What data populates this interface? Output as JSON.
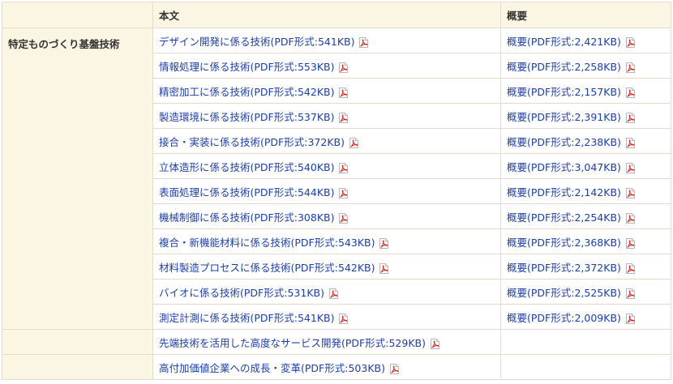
{
  "header": {
    "col_blank": "",
    "col_body": "本文",
    "col_summary": "概要"
  },
  "category": "特定ものづくり基盤技術",
  "rows": [
    {
      "body": "デザイン開発に係る技術",
      "body_size": "(PDF形式:541KB)",
      "summary": "概要",
      "summary_size": "(PDF形式:2,421KB)"
    },
    {
      "body": "情報処理に係る技術",
      "body_size": "(PDF形式:553KB)",
      "summary": "概要",
      "summary_size": "(PDF形式:2,258KB)"
    },
    {
      "body": "精密加工に係る技術",
      "body_size": "(PDF形式:542KB)",
      "summary": "概要",
      "summary_size": "(PDF形式:2,157KB)"
    },
    {
      "body": "製造環境に係る技術",
      "body_size": "(PDF形式:537KB)",
      "summary": "概要",
      "summary_size": "(PDF形式:2,391KB)"
    },
    {
      "body": "接合・実装に係る技術",
      "body_size": "(PDF形式:372KB)",
      "summary": "概要",
      "summary_size": "(PDF形式:2,238KB)"
    },
    {
      "body": "立体造形に係る技術",
      "body_size": "(PDF形式:540KB)",
      "summary": "概要",
      "summary_size": "(PDF形式:3,047KB)"
    },
    {
      "body": "表面処理に係る技術",
      "body_size": "(PDF形式:544KB)",
      "summary": "概要",
      "summary_size": "(PDF形式:2,142KB)"
    },
    {
      "body": "機械制御に係る技術",
      "body_size": "(PDF形式:308KB)",
      "summary": "概要",
      "summary_size": "(PDF形式:2,254KB)"
    },
    {
      "body": "複合・新機能材料に係る技術",
      "body_size": "(PDF形式:543KB)",
      "summary": "概要",
      "summary_size": "(PDF形式:2,368KB)"
    },
    {
      "body": "材料製造プロセスに係る技術",
      "body_size": "(PDF形式:542KB)",
      "summary": "概要",
      "summary_size": "(PDF形式:2,372KB)"
    },
    {
      "body": "バイオに係る技術",
      "body_size": "(PDF形式:531KB)",
      "summary": "概要",
      "summary_size": "(PDF形式:2,525KB)"
    },
    {
      "body": "測定計測に係る技術",
      "body_size": "(PDF形式:541KB)",
      "summary": "概要",
      "summary_size": "(PDF形式:2,009KB)"
    }
  ],
  "extra_rows": [
    {
      "body": "先端技術を活用した高度なサービス開発",
      "body_size": "(PDF形式:529KB)"
    },
    {
      "body": "高付加価値企業への成長・変革",
      "body_size": "(PDF形式:503KB)"
    }
  ],
  "icons": {
    "pdf": "pdf-icon"
  },
  "colors": {
    "link": "#1c3fa8",
    "header_bg": "#fbf6e3",
    "border": "#e4dccb",
    "pdf_red": "#d9241b"
  }
}
